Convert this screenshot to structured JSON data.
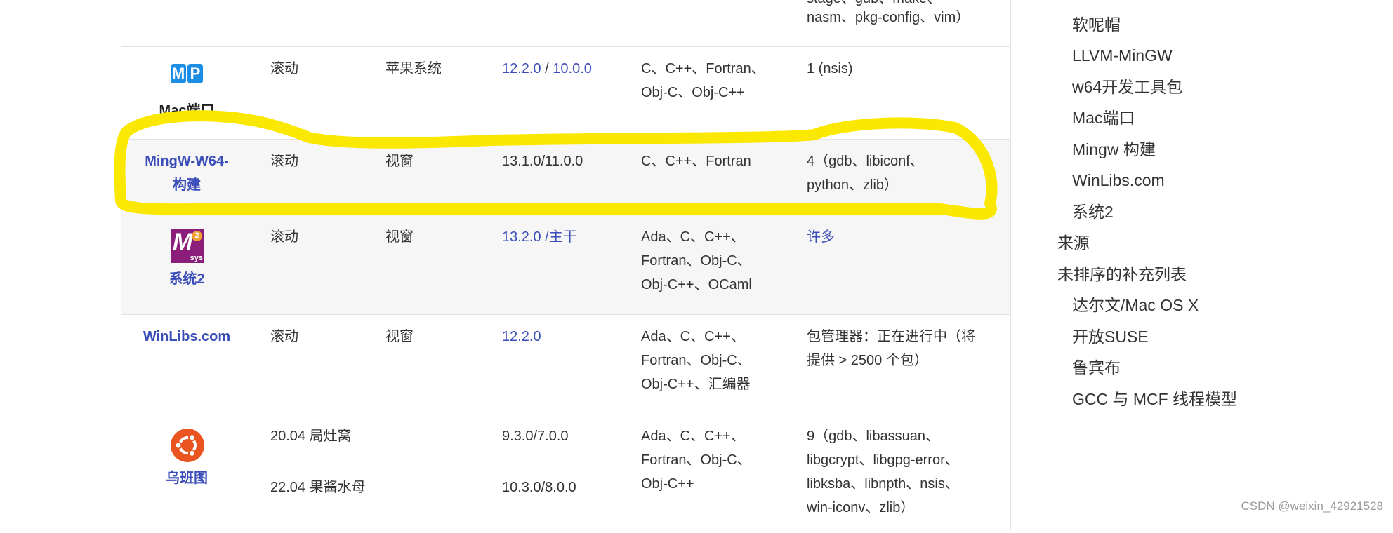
{
  "table": {
    "row_top": {
      "packages": "stage、gdb、make、",
      "packages_line2": "nasm、pkg-config、vim）"
    },
    "mac_ports": {
      "name": "Mac端口",
      "logo_letters": [
        "M",
        "P"
      ],
      "release": "滚动",
      "platform": "苹果系统",
      "gcc_version_a": "12.2.0",
      "gcc_version_sep": " / ",
      "gcc_version_b": "10.0.0",
      "languages": "C、C++、Fortran、",
      "languages_line2": "Obj-C、Obj-C++",
      "packages": "1 (nsis)"
    },
    "mingw_builds": {
      "name_line1": "MingW-W64-",
      "name_line2": "构建",
      "release": "滚动",
      "platform": "视窗",
      "gcc_version": "13.1.0/11.0.0",
      "languages": "C、C++、Fortran",
      "packages": "4（gdb、libiconf、",
      "packages_line2": "python、zlib）"
    },
    "msys2": {
      "name": "系统2",
      "logo_letter": "M",
      "logo_sub": "sys",
      "logo_badge": "2",
      "release": "滚动",
      "platform": "视窗",
      "gcc_version_a": "13.2.0",
      "gcc_version_sep": " /",
      "gcc_version_b": "主干",
      "languages": "Ada、C、C++、",
      "languages_line2": "Fortran、Obj-C、",
      "languages_line3": "Obj-C++、OCaml",
      "packages": "许多"
    },
    "winlibs": {
      "name": "WinLibs.com",
      "release": "滚动",
      "platform": "视窗",
      "gcc_version": "12.2.0",
      "languages": "Ada、C、C++、",
      "languages_line2": "Fortran、Obj-C、",
      "languages_line3": "Obj-C++、汇编器",
      "packages": "包管理器：正在进行中（将",
      "packages_line2": "提供 > 2500 个包）"
    },
    "ubuntu": {
      "name": "乌班图",
      "release_a": "20.04 局灶窝",
      "gcc_version_a": "9.3.0/7.0.0",
      "release_b": "22.04 果酱水母",
      "gcc_version_b": "10.3.0/8.0.0",
      "languages": "Ada、C、C++、",
      "languages_line2": "Fortran、Obj-C、",
      "languages_line3": "Obj-C++",
      "packages": "9（gdb、libassuan、",
      "packages_line2": "libgcrypt、libgpg-error、",
      "packages_line3": "libksba、libnpth、nsis、",
      "packages_line4": "win-iconv、zlib）"
    }
  },
  "toc": {
    "items": [
      {
        "label": "软呢帽",
        "level": 2
      },
      {
        "label": "LLVM-MinGW",
        "level": 2
      },
      {
        "label": "w64开发工具包",
        "level": 2
      },
      {
        "label": "Mac端口",
        "level": 2
      },
      {
        "label": "Mingw 构建",
        "level": 2
      },
      {
        "label": "WinLibs.com",
        "level": 2
      },
      {
        "label": "系统2",
        "level": 2
      },
      {
        "label": "来源",
        "level": 1
      },
      {
        "label": "未排序的补充列表",
        "level": 1
      },
      {
        "label": "达尔文/Mac OS X",
        "level": 2
      },
      {
        "label": "开放SUSE",
        "level": 2
      },
      {
        "label": "鲁宾布",
        "level": 2
      },
      {
        "label": "GCC 与 MCF 线程模型",
        "level": 2
      }
    ]
  },
  "watermark": "CSDN @weixin_42921528",
  "colors": {
    "link": "#3a4db8",
    "highlight": "#fbe800",
    "macports_blue": "#1c8ee6",
    "msys_purple": "#8a1e7a",
    "ubuntu_orange": "#e95420"
  }
}
